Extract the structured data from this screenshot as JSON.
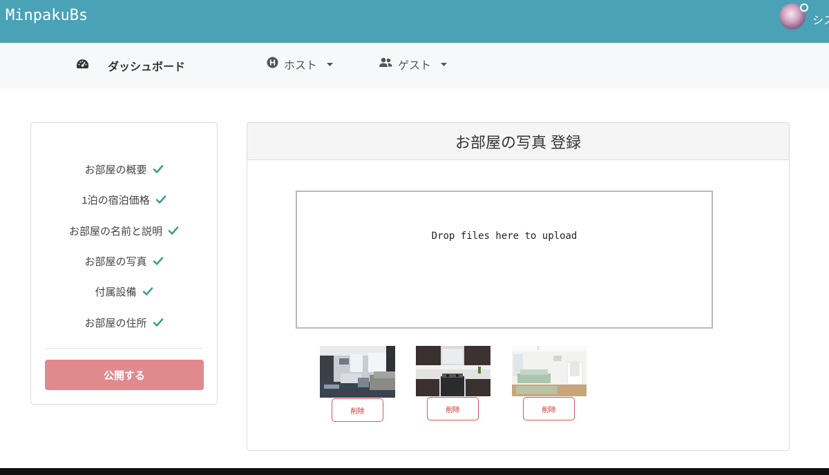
{
  "app": {
    "brand": "MinpakuBs",
    "user_name": "シス"
  },
  "nav": {
    "dashboard": "ダッシュボード",
    "host": "ホスト",
    "guest": "ゲスト"
  },
  "sidebar": {
    "items": [
      {
        "label": "お部屋の概要",
        "done": true
      },
      {
        "label": "1泊の宿泊価格",
        "done": true
      },
      {
        "label": "お部屋の名前と説明",
        "done": true
      },
      {
        "label": "お部屋の写真",
        "done": true
      },
      {
        "label": "付属設備",
        "done": true
      },
      {
        "label": "お部屋の住所",
        "done": true
      }
    ],
    "publish_label": "公開する"
  },
  "main": {
    "title": "お部屋の写真 登録",
    "dropzone_text": "Drop files here to upload",
    "photos": [
      {
        "delete_label": "削除"
      },
      {
        "delete_label": "削除"
      },
      {
        "delete_label": "削除"
      }
    ]
  },
  "colors": {
    "topbar": "#4aa2b7",
    "navbar": "#f7f8f9",
    "check": "#3a9e8f",
    "publish_button": "#e08a8d",
    "delete_border": "#d9534f"
  },
  "icons": {
    "dashboard": "tachometer-icon",
    "host": "h-circle-icon",
    "guest": "users-icon",
    "dropdown": "caret-down-icon",
    "complete": "check-icon"
  }
}
